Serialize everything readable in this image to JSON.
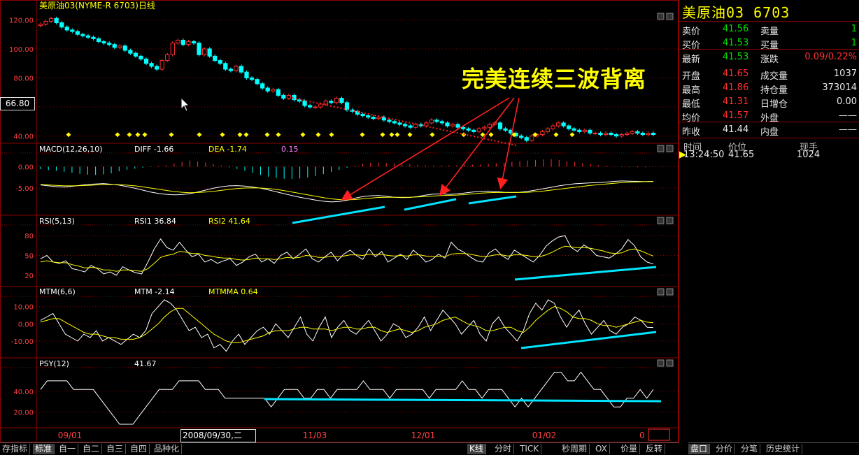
{
  "chart_title": "美原油03(NYME-R 6703)日线",
  "annotation": "完美连续三波背离",
  "crosshair_price": "66.80",
  "crosshair_date": "2008/09/30,二",
  "colors": {
    "up": "#ff3030",
    "down": "#00ffff",
    "fast": "#ffffff",
    "slow": "#ffff00",
    "grid": "#8b0000",
    "trend": "#00e5ff",
    "arrow": "#ff2020"
  },
  "chart_data": [
    {
      "type": "candlestick",
      "panel": "price",
      "title": "美原油03(NYME-R 6703)日线",
      "ylim": [
        35,
        125
      ],
      "yticks": [
        "120.00",
        "100.00",
        "80.00",
        "60.00",
        "40.00"
      ],
      "ytick_values": [
        120,
        100,
        80,
        60,
        40
      ],
      "xticks": [
        "09/01",
        "11/03",
        "12/01",
        "01/02",
        "0"
      ],
      "closes": [
        117,
        119,
        121,
        118,
        115,
        113,
        112,
        110,
        109,
        108,
        107,
        105,
        104,
        103,
        101,
        102,
        99,
        97,
        95,
        93,
        90,
        88,
        86,
        92,
        96,
        104,
        106,
        103,
        105,
        104,
        96,
        100,
        95,
        92,
        90,
        86,
        85,
        88,
        84,
        80,
        79,
        76,
        73,
        71,
        72,
        68,
        66,
        68,
        65,
        64,
        61,
        60,
        60,
        62,
        64,
        63,
        66,
        63,
        58,
        57,
        55,
        54,
        53,
        52,
        53,
        51,
        50,
        49,
        48,
        47,
        46,
        48,
        47,
        49,
        51,
        50,
        49,
        47,
        48,
        46,
        45,
        44,
        43,
        45,
        46,
        48,
        49,
        45,
        44,
        42,
        40,
        39,
        37,
        40,
        41,
        43,
        45,
        47,
        49,
        47,
        45,
        44,
        43,
        44,
        42,
        42,
        41,
        42,
        41,
        40,
        41,
        42,
        43,
        42,
        41,
        42,
        41
      ]
    },
    {
      "type": "line",
      "panel": "macd",
      "title": "MACD(12,26,10)",
      "labels": {
        "DIFF": "-1.66",
        "DEA": "-1.74",
        "MACD": "0.15"
      },
      "yticks": [
        "0.00",
        "-5.00"
      ],
      "ytick_values": [
        0,
        -5
      ],
      "series": [
        {
          "name": "DIFF",
          "values": [
            -3.2,
            -3.6,
            -3.9,
            -4.1,
            -3.8,
            -3.4,
            -3.0,
            -2.8,
            -2.6,
            -2.9,
            -3.3,
            -3.9,
            -4.6,
            -5.4,
            -6.2,
            -6.8,
            -7.2,
            -7.4,
            -7.3,
            -6.9,
            -6.2,
            -5.4,
            -4.6,
            -4.0,
            -3.6,
            -3.5,
            -3.7,
            -4.1,
            -4.6,
            -5.3,
            -6.1,
            -6.9,
            -7.7,
            -8.4,
            -9.0,
            -9.6,
            -10.1,
            -10.4,
            -10.2,
            -9.7,
            -8.8,
            -8.1,
            -7.8,
            -7.7,
            -8.0,
            -8.4,
            -8.6,
            -8.5,
            -8.1,
            -7.5,
            -7.1,
            -7.0,
            -7.2,
            -7.0,
            -6.6,
            -6.2,
            -5.9,
            -5.8,
            -6.0,
            -6.3,
            -6.4,
            -6.3,
            -5.9,
            -5.4,
            -4.8,
            -4.2,
            -3.6,
            -3.1,
            -2.7,
            -2.5,
            -2.3,
            -2.2,
            -2.0,
            -1.7,
            -1.5,
            -1.6,
            -1.7,
            -1.8,
            -1.66
          ]
        },
        {
          "name": "DEA",
          "values": [
            -3.0,
            -3.2,
            -3.4,
            -3.6,
            -3.6,
            -3.5,
            -3.4,
            -3.2,
            -3.1,
            -3.0,
            -3.1,
            -3.3,
            -3.6,
            -4.0,
            -4.5,
            -5.0,
            -5.5,
            -6.0,
            -6.3,
            -6.5,
            -6.4,
            -6.2,
            -5.9,
            -5.5,
            -5.1,
            -4.7,
            -4.5,
            -4.4,
            -4.5,
            -4.7,
            -5.1,
            -5.6,
            -6.2,
            -6.8,
            -7.4,
            -8.0,
            -8.6,
            -9.1,
            -9.4,
            -9.5,
            -9.4,
            -9.1,
            -8.8,
            -8.5,
            -8.4,
            -8.4,
            -8.4,
            -8.4,
            -8.3,
            -8.1,
            -7.9,
            -7.7,
            -7.6,
            -7.5,
            -7.3,
            -7.0,
            -6.7,
            -6.5,
            -6.4,
            -6.4,
            -6.4,
            -6.4,
            -6.3,
            -6.1,
            -5.8,
            -5.4,
            -5.0,
            -4.6,
            -4.2,
            -3.8,
            -3.4,
            -3.1,
            -2.8,
            -2.5,
            -2.2,
            -2.0,
            -1.9,
            -1.8,
            -1.74
          ]
        }
      ],
      "histogram": [
        -1,
        -1.3,
        -1.6,
        -2,
        -2.4,
        -2.8,
        -3.1,
        -3.2,
        -3.0,
        -2.6,
        -1.8,
        -1.2,
        -0.8,
        -0.4,
        -0.1,
        0.2,
        0.6,
        1.2,
        1.8,
        2.4,
        2.0,
        1.6,
        1.0,
        0.4,
        -0.3,
        -0.9,
        -1.6,
        -2.4,
        -3.2,
        -3.9,
        -4.4,
        -4.7,
        -4.8,
        -4.6,
        -4.2,
        -3.6,
        -2.9,
        -2.1,
        -1.3,
        -0.5,
        0.3,
        1.0,
        1.5,
        1.6,
        1.5,
        1.3,
        1.1,
        0.9,
        0.7,
        0.5,
        0.4,
        0.4,
        0.5,
        0.6,
        0.7,
        0.8,
        0.9,
        1.1,
        1.3,
        1.5,
        1.8,
        2.1,
        2.4,
        2.6,
        2.8,
        2.9,
        2.6,
        2.2,
        1.8,
        1.4,
        1.0,
        0.6,
        0.3,
        0.1,
        -0.1,
        -0.2,
        -0.2,
        -0.2,
        0.15
      ]
    },
    {
      "type": "line",
      "panel": "rsi",
      "title": "RSI(5,13)",
      "labels": {
        "RSI1": "36.84",
        "RSI2": "41.64"
      },
      "yticks": [
        "80",
        "50",
        "20"
      ],
      "ytick_values": [
        80,
        50,
        20
      ],
      "series": [
        {
          "name": "RSI1",
          "values": [
            45,
            50,
            40,
            38,
            42,
            30,
            28,
            25,
            35,
            30,
            22,
            25,
            20,
            33,
            28,
            24,
            22,
            40,
            60,
            75,
            62,
            58,
            70,
            58,
            48,
            52,
            40,
            44,
            38,
            42,
            45,
            35,
            40,
            48,
            52,
            40,
            45,
            38,
            50,
            55,
            45,
            52,
            60,
            45,
            40,
            48,
            55,
            42,
            52,
            58,
            50,
            44,
            60,
            48,
            56,
            40,
            46,
            52,
            44,
            58,
            50,
            40,
            44,
            52,
            46,
            70,
            60,
            55,
            48,
            42,
            40,
            54,
            60,
            50,
            44,
            58,
            52,
            46,
            40,
            50,
            64,
            72,
            78,
            80,
            62,
            56,
            66,
            60,
            50,
            48,
            46,
            52,
            60,
            74,
            65,
            48,
            40,
            37
          ]
        },
        {
          "name": "RSI2",
          "values": [
            40,
            42,
            40,
            39,
            39,
            36,
            34,
            31,
            32,
            31,
            28,
            28,
            26,
            28,
            28,
            27,
            26,
            30,
            38,
            47,
            50,
            52,
            56,
            55,
            53,
            53,
            50,
            49,
            47,
            46,
            46,
            44,
            43,
            44,
            46,
            45,
            45,
            44,
            45,
            47,
            46,
            47,
            50,
            49,
            47,
            47,
            49,
            48,
            49,
            51,
            51,
            50,
            52,
            51,
            52,
            50,
            49,
            50,
            49,
            51,
            51,
            49,
            48,
            49,
            48,
            52,
            53,
            53,
            52,
            50,
            48,
            49,
            51,
            51,
            49,
            51,
            51,
            50,
            48,
            48,
            51,
            55,
            60,
            64,
            63,
            62,
            62,
            61,
            59,
            57,
            54,
            53,
            54,
            58,
            60,
            57,
            53,
            49
          ]
        }
      ]
    },
    {
      "type": "line",
      "panel": "mtm",
      "title": "MTM(6,6)",
      "labels": {
        "MTM": "-2.14",
        "MTMMA": "0.64"
      },
      "yticks": [
        "10.00",
        "0.00",
        "-10.00"
      ],
      "ytick_values": [
        10,
        0,
        -10
      ],
      "series": [
        {
          "name": "MTM",
          "values": [
            2,
            4,
            6,
            0,
            -6,
            -8,
            -10,
            -6,
            -8,
            -4,
            -10,
            -8,
            -10,
            -12,
            -9,
            -6,
            -8,
            -4,
            6,
            10,
            14,
            12,
            8,
            2,
            -4,
            -2,
            -8,
            -6,
            -14,
            -12,
            -16,
            -10,
            -6,
            -12,
            -8,
            -4,
            -2,
            -6,
            0,
            -4,
            -8,
            -2,
            4,
            -6,
            -10,
            -2,
            4,
            -8,
            -2,
            2,
            -4,
            -6,
            -2,
            2,
            -4,
            -10,
            -6,
            0,
            -2,
            -8,
            -6,
            -2,
            4,
            -4,
            2,
            8,
            4,
            0,
            -6,
            -2,
            2,
            -6,
            -10,
            0,
            4,
            -2,
            -6,
            -10,
            -4,
            6,
            12,
            8,
            14,
            12,
            4,
            -2,
            4,
            8,
            0,
            -6,
            -2,
            2,
            -4,
            -6,
            -2,
            0,
            4,
            2,
            -2,
            -2.14
          ]
        },
        {
          "name": "MTMMA",
          "values": [
            1,
            2,
            3,
            3,
            1,
            -1,
            -3,
            -5,
            -6,
            -6,
            -7,
            -8,
            -8,
            -9,
            -9,
            -9,
            -8,
            -6,
            -3,
            0,
            4,
            7,
            9,
            9,
            6,
            3,
            0,
            -3,
            -6,
            -8,
            -10,
            -11,
            -11,
            -10,
            -9,
            -8,
            -7,
            -5,
            -4,
            -4,
            -4,
            -3,
            -2,
            -2,
            -3,
            -3,
            -3,
            -4,
            -3,
            -2,
            -2,
            -3,
            -3,
            -2,
            -2,
            -4,
            -5,
            -4,
            -3,
            -4,
            -5,
            -4,
            -2,
            -1,
            0,
            2,
            3,
            4,
            2,
            0,
            -1,
            -2,
            -4,
            -4,
            -3,
            -2,
            -2,
            -4,
            -5,
            -2,
            2,
            5,
            8,
            10,
            9,
            7,
            4,
            3,
            3,
            2,
            0,
            -1,
            -1,
            -2,
            -1,
            0,
            1,
            2,
            1,
            0.64
          ]
        }
      ]
    },
    {
      "type": "line",
      "panel": "psy",
      "title": "PSY(12)",
      "labels": {
        "PSY": "41.67"
      },
      "yticks": [
        "40.00",
        "20.00"
      ],
      "ytick_values": [
        40,
        20
      ],
      "series": [
        {
          "name": "PSY",
          "values": [
            41.67,
            50,
            50,
            50,
            50,
            41.67,
            41.67,
            41.67,
            41.67,
            33.33,
            25,
            16.67,
            8.33,
            8.33,
            8.33,
            16.67,
            25,
            33.33,
            41.67,
            41.67,
            41.67,
            50,
            50,
            50,
            50,
            41.67,
            41.67,
            41.67,
            33.33,
            33.33,
            33.33,
            33.33,
            33.33,
            33.33,
            33.33,
            25,
            33.33,
            41.67,
            41.67,
            41.67,
            33.33,
            33.33,
            41.67,
            41.67,
            33.33,
            41.67,
            41.67,
            41.67,
            41.67,
            50,
            41.67,
            41.67,
            41.67,
            33.33,
            41.67,
            41.67,
            41.67,
            41.67,
            41.67,
            33.33,
            41.67,
            41.67,
            41.67,
            41.67,
            50,
            41.67,
            41.67,
            33.33,
            41.67,
            41.67,
            41.67,
            33.33,
            25,
            33.33,
            25,
            33.33,
            41.67,
            50,
            58.33,
            58.33,
            50,
            50,
            58.33,
            50,
            41.67,
            41.67,
            33.33,
            25,
            25,
            33.33,
            33.33,
            41.67,
            33.33,
            41.67
          ]
        }
      ]
    }
  ],
  "quote": {
    "title": "美原油03  6703",
    "rows": [
      {
        "l1": "卖价",
        "v1": "41.56",
        "c1": "grn",
        "l2": "卖量",
        "v2": "1",
        "c2": "grn"
      },
      {
        "l1": "买价",
        "v1": "41.53",
        "c1": "grn",
        "l2": "买量",
        "v2": "1",
        "c2": "grn"
      },
      {
        "l1": "最新",
        "v1": "41.53",
        "c1": "grn",
        "l2": "涨跌",
        "v2": "0.09/0.22%",
        "c2": "red"
      },
      {
        "l1": "开盘",
        "v1": "41.65",
        "c1": "red",
        "l2": "成交量",
        "v2": "1037",
        "c2": "wht"
      },
      {
        "l1": "最高",
        "v1": "41.86",
        "c1": "red",
        "l2": "持仓量",
        "v2": "373014",
        "c2": "wht"
      },
      {
        "l1": "最低",
        "v1": "41.31",
        "c1": "red",
        "l2": "日增仓",
        "v2": "0.00",
        "c2": "wht"
      },
      {
        "l1": "均价",
        "v1": "41.57",
        "c1": "red",
        "l2": "外盘",
        "v2": "——",
        "c2": "wht"
      },
      {
        "l1": "昨收",
        "v1": "41.44",
        "c1": "wht",
        "l2": "内盘",
        "v2": "——",
        "c2": "wht"
      }
    ],
    "tick_header": {
      "time": "时间",
      "price": "价位",
      "vol": "现手"
    },
    "tick": {
      "time": "13:24:50",
      "price": "41.65",
      "vol": "1024"
    }
  },
  "bottom_tabs": [
    "存指标",
    "标准",
    "自一",
    "自二",
    "自三",
    "自四",
    "品种化"
  ],
  "period_tabs": [
    "K线",
    "分时",
    "TICK",
    "秒周期",
    "OX",
    "价量",
    "反转"
  ],
  "right_tabs": [
    "盘口",
    "分价",
    "分笔",
    "历史统计"
  ]
}
